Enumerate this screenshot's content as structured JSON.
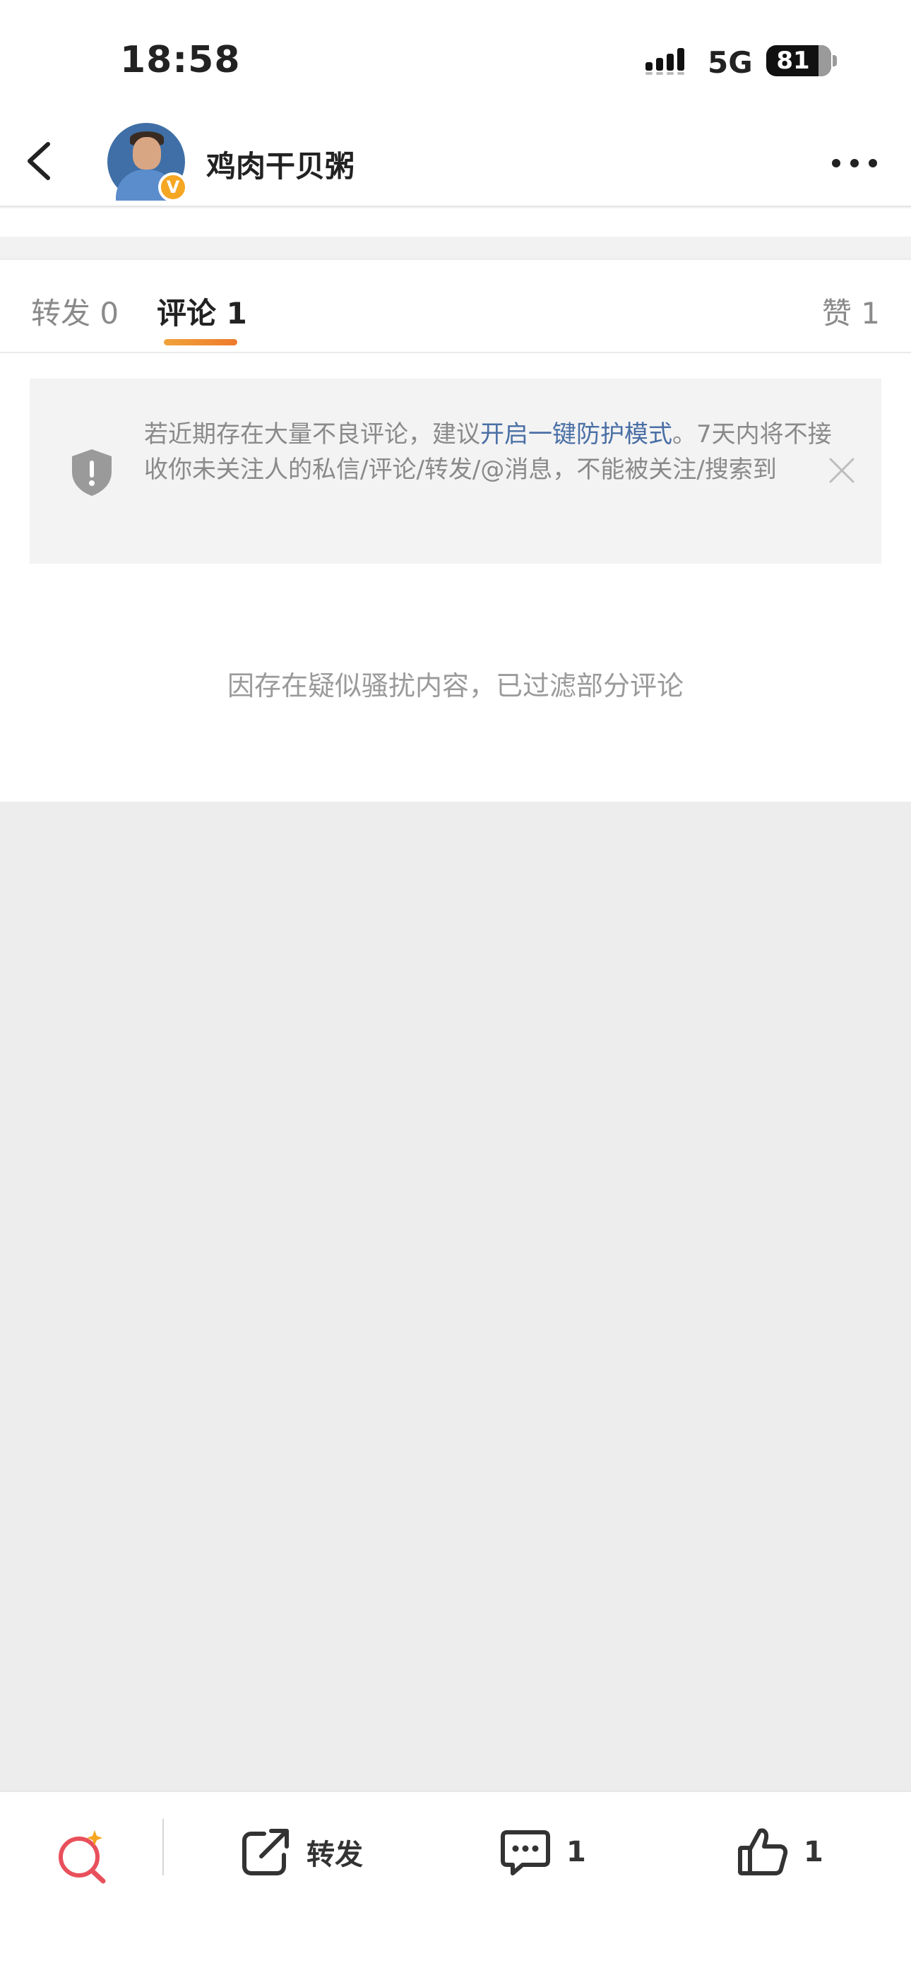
{
  "status_bar": {
    "time": "18:58",
    "network": "5G",
    "battery": "81",
    "battery_level": 0.81
  },
  "nav": {
    "title": "鸡肉干贝粥",
    "verified_badge": "V"
  },
  "tabs": {
    "repost": "转发 0",
    "comment": "评论 1",
    "like": "赞 1"
  },
  "notice": {
    "text_before": "若近期存在大量不良评论，建议",
    "link": "开启一键防护模式",
    "text_after": "。7天内将不接收你未关注人的私信/评论/转发/@消息，不能被关注/搜索到"
  },
  "filter_message": "因存在疑似骚扰内容，已过滤部分评论",
  "toolbar": {
    "repost_label": "转发",
    "comment_count": "1",
    "like_count": "1"
  },
  "colors": {
    "accent_orange": "#ee7a2c",
    "link_blue": "#4a6fa5",
    "search_red": "#e8505b"
  }
}
